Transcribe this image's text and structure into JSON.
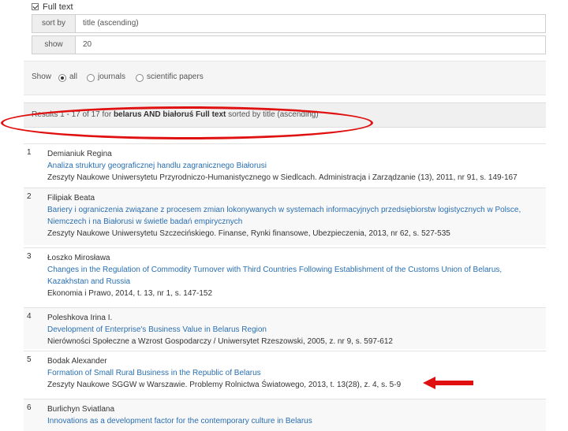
{
  "fulltext": {
    "label": "Full text"
  },
  "sort": {
    "label": "sort by",
    "value": "title (ascending)"
  },
  "show": {
    "label": "show",
    "value": "20"
  },
  "show_filter": {
    "label": "Show",
    "options": [
      "all",
      "journals",
      "scientific papers"
    ],
    "selected": "all"
  },
  "results_bar": {
    "prefix": "Results 1 - 17 of 17 for ",
    "query": "belarus AND białoruś Full text",
    "suffix": " sorted by title (ascending)"
  },
  "results": [
    {
      "num": "1",
      "author": "Demianiuk Regina",
      "title": [
        "Analiza struktury geograficznej handlu zagranicznego Białorusi"
      ],
      "source": "Zeszyty Naukowe Uniwersytetu Przyrodniczo-Humanistycznego w Siedlcach. Administracja i Zarządzanie (13), 2011, nr 91, s. 149-167"
    },
    {
      "num": "2",
      "author": "Filipiak Beata",
      "title": [
        "Bariery i ograniczenia związane z procesem zmian lokonywanych w systemach informacyjnych przedsiębiorstw logistycznych w Polsce,",
        "Niemczech i na Białorusi w świetle badań empirycznych"
      ],
      "source": "Zeszyty Naukowe Uniwersytetu Szczecińskiego. Finanse, Rynki finansowe, Ubezpieczenia, 2013, nr 62, s. 527-535"
    },
    {
      "num": "3",
      "author": "Łoszko Mirosława",
      "title": [
        "Changes in the Regulation of Commodity Turnover with Third Countries Following Establishment of the Customs Union of Belarus,",
        "Kazakhstan and Russia"
      ],
      "source": "Ekonomia i Prawo, 2014, t. 13, nr 1, s. 147-152"
    },
    {
      "num": "4",
      "author": "Poleshkova Irina I.",
      "title": [
        "Development of Enterprise's Business Value in Belarus Region"
      ],
      "source": "Nierówności Społeczne a Wzrost Gospodarczy / Uniwersytet Rzeszowski, 2005, z. nr 9, s. 597-612"
    },
    {
      "num": "5",
      "author": "Bodak Alexander",
      "title": [
        "Formation of Small Rural Business in the Republic of Belarus"
      ],
      "source": "Zeszyty Naukowe SGGW w Warszawie. Problemy Rolnictwa Światowego, 2013, t. 13(28), z. 4, s. 5-9"
    },
    {
      "num": "6",
      "author": "Burlichyn Sviatlana",
      "title": [
        "Innovations as a development factor for the contemporary culture in Belarus"
      ],
      "source": ""
    }
  ],
  "colors": {
    "link": "#2a6fb0",
    "highlight": "#e01010"
  }
}
